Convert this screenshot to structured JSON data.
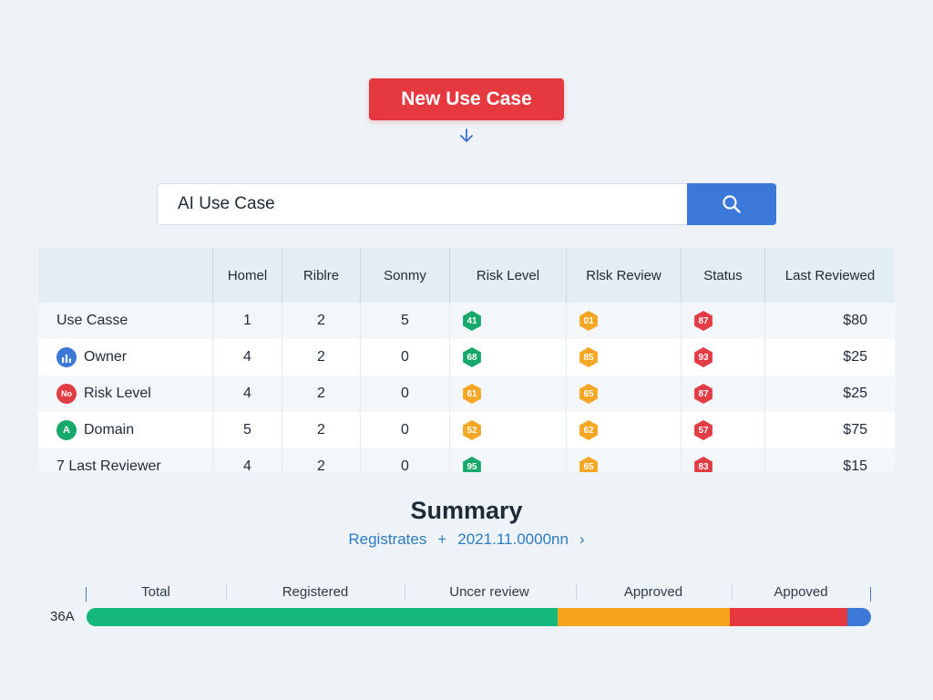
{
  "header": {
    "new_button_label": "New Use Case"
  },
  "search": {
    "value": "AI Use Case",
    "icon": "search-icon"
  },
  "table": {
    "columns": [
      "",
      "Homel",
      "Riblre",
      "Sonmy",
      "Risk Level",
      "Rlsk Review",
      "Status",
      "Last Reviewed"
    ],
    "rows": [
      {
        "label": "Use Casse",
        "icon": "",
        "c1": "1",
        "c2": "2",
        "c3": "5",
        "risk": "41",
        "review": "01",
        "status": "87",
        "last": "$80"
      },
      {
        "label": "Owner",
        "icon": "chart-icon",
        "icon_text": "",
        "c1": "4",
        "c2": "2",
        "c3": "0",
        "risk": "68",
        "review": "85",
        "status": "93",
        "last": "$25"
      },
      {
        "label": "Risk Level",
        "icon": "no-icon",
        "icon_text": "No",
        "c1": "4",
        "c2": "2",
        "c3": "0",
        "risk": "61",
        "review": "65",
        "status": "87",
        "last": "$25"
      },
      {
        "label": "Domain",
        "icon": "a-icon",
        "icon_text": "A",
        "c1": "5",
        "c2": "2",
        "c3": "0",
        "risk": "52",
        "review": "62",
        "status": "57",
        "last": "$75"
      },
      {
        "label": "7 Last Reviewer",
        "icon": "",
        "c1": "4",
        "c2": "2",
        "c3": "0",
        "risk": "95",
        "review": "65",
        "status": "83",
        "last": "$15"
      }
    ]
  },
  "summary": {
    "title": "Summary",
    "sub_left": "Registrates",
    "sub_sep": "+",
    "sub_right": "2021.11.0000nn",
    "chevron": "›"
  },
  "progress": {
    "axis_label": "36A",
    "labels": [
      "Total",
      "Registered",
      "Uncer review",
      "Approved",
      "Appoved"
    ],
    "segments": [
      {
        "name": "green",
        "fraction": 0.6,
        "color": "#14b87a"
      },
      {
        "name": "orange",
        "fraction": 0.22,
        "color": "#f6a51b"
      },
      {
        "name": "red",
        "fraction": 0.15,
        "color": "#e5393f"
      },
      {
        "name": "blue",
        "fraction": 0.03,
        "color": "#3c78d8"
      }
    ]
  },
  "colors": {
    "accent_red": "#e5393f",
    "accent_blue": "#3c78d8",
    "green": "#17a86b",
    "orange": "#f5a623"
  }
}
